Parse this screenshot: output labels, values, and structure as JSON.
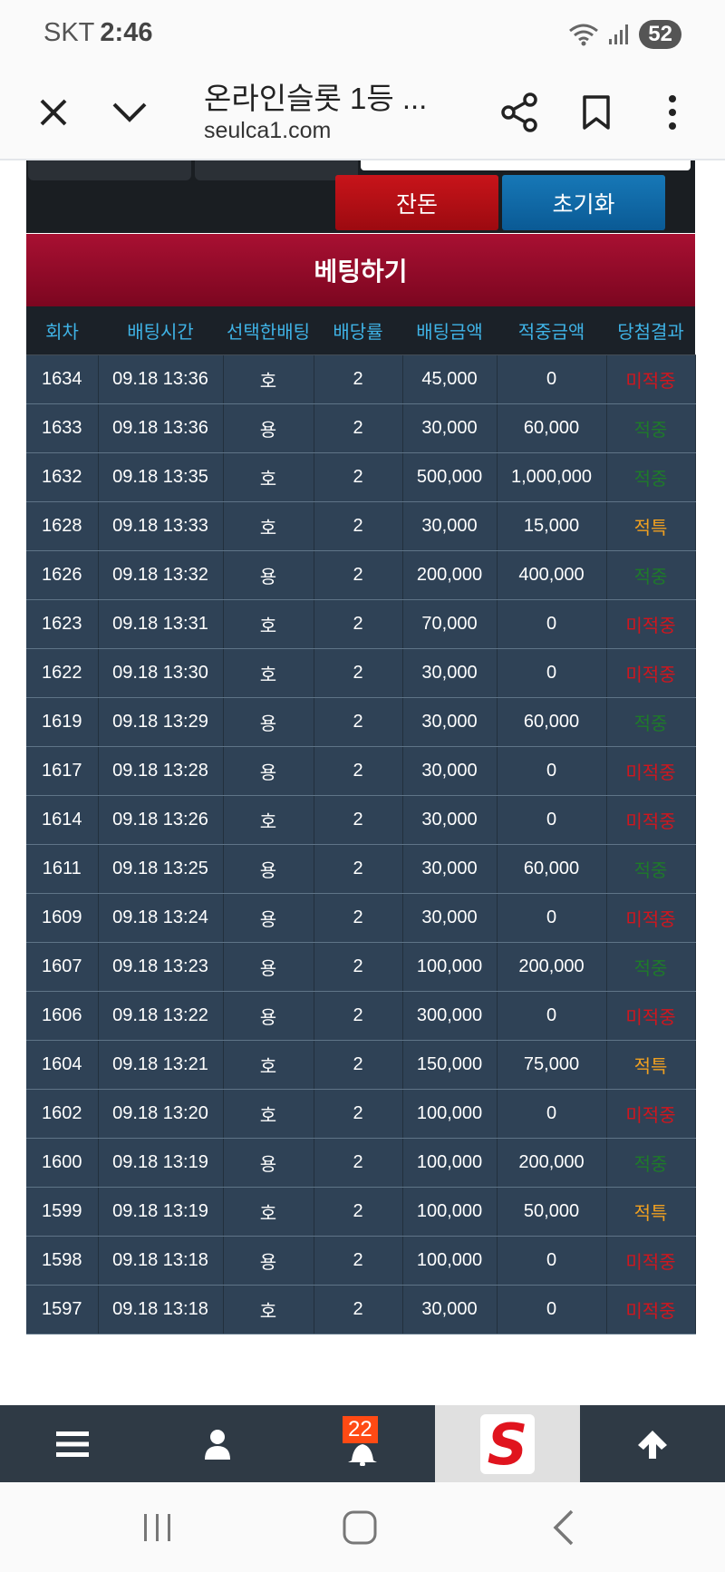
{
  "status": {
    "carrier": "SKT",
    "time": "2:46",
    "battery": "52"
  },
  "browser": {
    "title": "온라인슬롯 1등 ...",
    "url": "seulca1.com"
  },
  "panel": {
    "btn_balance": "잔돈",
    "btn_reset": "초기화",
    "header": "베팅하기"
  },
  "table": {
    "headers": [
      "회차",
      "배팅시간",
      "선택한배팅",
      "배당률",
      "배팅금액",
      "적중금액",
      "당첨결과"
    ],
    "rows": [
      [
        "1634",
        "09.18 13:36",
        "호",
        "2",
        "45,000",
        "0",
        "미적중"
      ],
      [
        "1633",
        "09.18 13:36",
        "용",
        "2",
        "30,000",
        "60,000",
        "적중"
      ],
      [
        "1632",
        "09.18 13:35",
        "호",
        "2",
        "500,000",
        "1,000,000",
        "적중"
      ],
      [
        "1628",
        "09.18 13:33",
        "호",
        "2",
        "30,000",
        "15,000",
        "적특"
      ],
      [
        "1626",
        "09.18 13:32",
        "용",
        "2",
        "200,000",
        "400,000",
        "적중"
      ],
      [
        "1623",
        "09.18 13:31",
        "호",
        "2",
        "70,000",
        "0",
        "미적중"
      ],
      [
        "1622",
        "09.18 13:30",
        "호",
        "2",
        "30,000",
        "0",
        "미적중"
      ],
      [
        "1619",
        "09.18 13:29",
        "용",
        "2",
        "30,000",
        "60,000",
        "적중"
      ],
      [
        "1617",
        "09.18 13:28",
        "용",
        "2",
        "30,000",
        "0",
        "미적중"
      ],
      [
        "1614",
        "09.18 13:26",
        "호",
        "2",
        "30,000",
        "0",
        "미적중"
      ],
      [
        "1611",
        "09.18 13:25",
        "용",
        "2",
        "30,000",
        "60,000",
        "적중"
      ],
      [
        "1609",
        "09.18 13:24",
        "용",
        "2",
        "30,000",
        "0",
        "미적중"
      ],
      [
        "1607",
        "09.18 13:23",
        "용",
        "2",
        "100,000",
        "200,000",
        "적중"
      ],
      [
        "1606",
        "09.18 13:22",
        "용",
        "2",
        "300,000",
        "0",
        "미적중"
      ],
      [
        "1604",
        "09.18 13:21",
        "호",
        "2",
        "150,000",
        "75,000",
        "적특"
      ],
      [
        "1602",
        "09.18 13:20",
        "호",
        "2",
        "100,000",
        "0",
        "미적중"
      ],
      [
        "1600",
        "09.18 13:19",
        "용",
        "2",
        "100,000",
        "200,000",
        "적중"
      ],
      [
        "1599",
        "09.18 13:19",
        "호",
        "2",
        "100,000",
        "50,000",
        "적특"
      ],
      [
        "1598",
        "09.18 13:18",
        "용",
        "2",
        "100,000",
        "0",
        "미적중"
      ],
      [
        "1597",
        "09.18 13:18",
        "호",
        "2",
        "30,000",
        "0",
        "미적중"
      ]
    ]
  },
  "result_colors": {
    "미적중": "#d0161e",
    "적중": "#1e7a2a",
    "적특": "#f0a020"
  },
  "bottom_nav": {
    "badge": "22",
    "logo_letter": "S"
  },
  "colors": {
    "header_red": "#a81032",
    "row_bg": "#2f4256",
    "header_text": "#3fb3e6",
    "btn_red": "#c8141a",
    "btn_blue": "#1778b7"
  }
}
